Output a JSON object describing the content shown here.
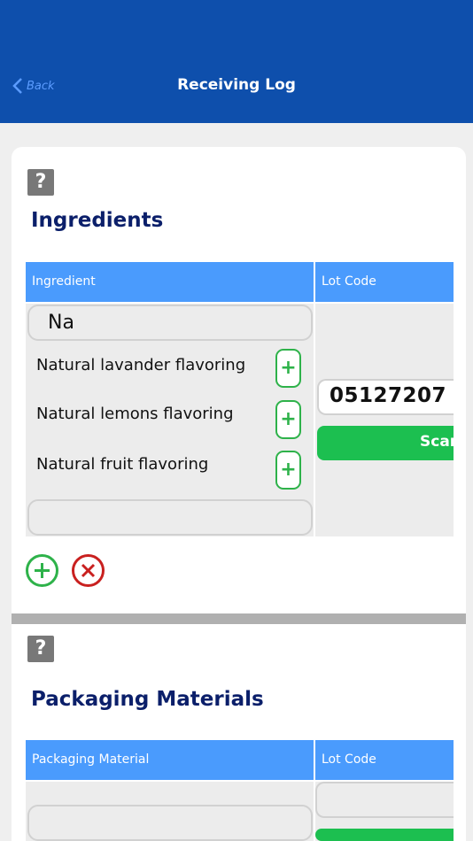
{
  "header": {
    "back_label": "Back",
    "title": "Receiving Log"
  },
  "ingredients": {
    "help_label": "?",
    "title": "Ingredients",
    "col_ingredient": "Ingredient",
    "col_lot": "Lot Code",
    "search_value": "Na",
    "suggestions": [
      {
        "label": "Natural lavander flavoring",
        "add_label": "+"
      },
      {
        "label": "Natural lemons flavoring",
        "add_label": "+"
      },
      {
        "label": "Natural fruit flavoring",
        "add_label": "+"
      }
    ],
    "lot_value": "05127207",
    "scan_label": "Scan"
  },
  "packaging": {
    "help_label": "?",
    "title": "Packaging Materials",
    "col_material": "Packaging Material",
    "col_lot": "Lot Code"
  },
  "colors": {
    "header": "#0e4fac",
    "table_header": "#4a9bfd",
    "green": "#2eb24a",
    "red": "#c9201f",
    "title": "#0b1f6a"
  }
}
